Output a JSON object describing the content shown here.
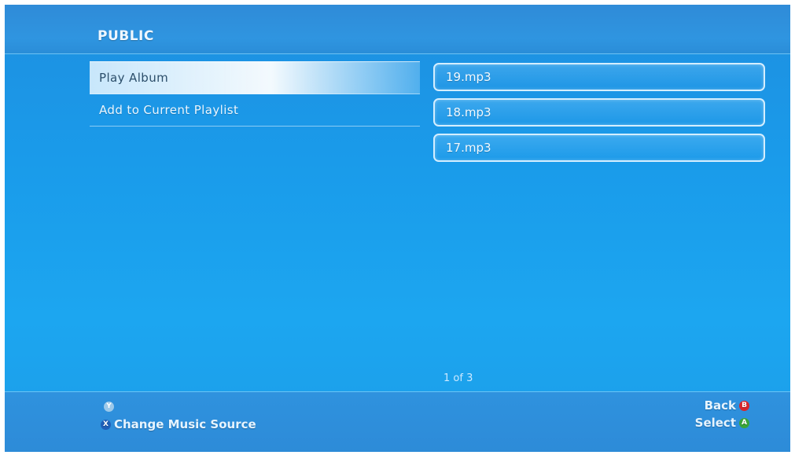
{
  "header": {
    "title": "PUBLIC"
  },
  "menu": {
    "items": [
      {
        "label": "Play Album",
        "selected": true
      },
      {
        "label": "Add to Current Playlist",
        "selected": false
      }
    ]
  },
  "files": [
    {
      "name": "19.mp3"
    },
    {
      "name": "18.mp3"
    },
    {
      "name": "17.mp3"
    }
  ],
  "pagination": {
    "text": "1 of 3"
  },
  "footer": {
    "y_glyph": "Y",
    "x_glyph": "X",
    "change_source_label": "Change Music Source",
    "back_label": "Back",
    "back_glyph": "B",
    "select_label": "Select",
    "select_glyph": "A"
  },
  "colors": {
    "background": "#1b9de8",
    "back_button": "#d8262c",
    "select_button": "#3aa53a",
    "x_button": "#1f5fb8"
  }
}
